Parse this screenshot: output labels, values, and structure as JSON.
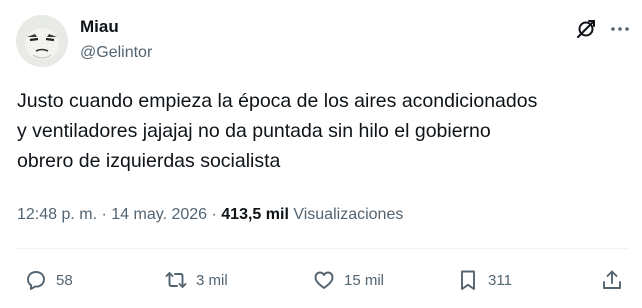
{
  "author": {
    "display_name": "Miau",
    "handle": "@Gelintor"
  },
  "tweet": {
    "text": "Justo cuando empieza la época de los aires acondicionados\ny ventiladores jajajaj no da puntada sin hilo el gobierno\nobrero de izquierdas socialista"
  },
  "meta": {
    "time": "12:48 p. m.",
    "separator": "·",
    "date": "14 may. 2026",
    "views_count": "413,5 mil",
    "views_label": "Visualizaciones"
  },
  "actions": {
    "replies": "58",
    "retweets": "3 mil",
    "likes": "15 mil",
    "bookmarks": "311"
  },
  "icons": {
    "avatar": "avatar",
    "grok": "grok-icon",
    "more": "more-icon",
    "reply": "reply-icon",
    "retweet": "retweet-icon",
    "like": "heart-icon",
    "bookmark": "bookmark-icon",
    "share": "share-icon"
  },
  "colors": {
    "text_primary": "#0f1419",
    "text_secondary": "#536471",
    "divider": "#eff3f4",
    "background": "#ffffff"
  }
}
